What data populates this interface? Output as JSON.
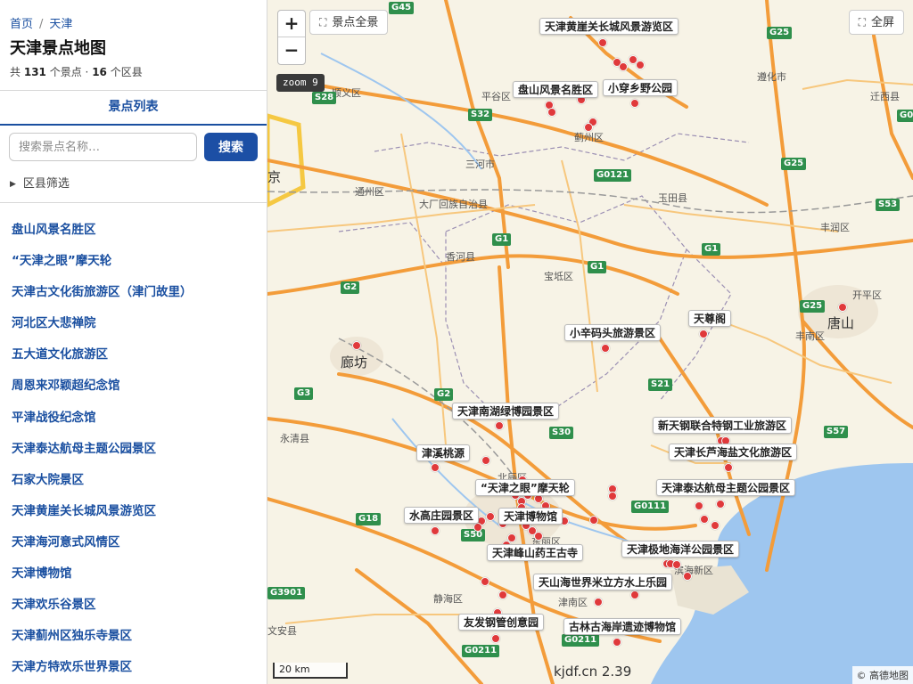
{
  "breadcrumb": {
    "home": "首页",
    "separator": "/",
    "current": "天津"
  },
  "page_title": "天津景点地图",
  "stats": {
    "prefix": "共",
    "poi_count": "131",
    "poi_unit": "个景点 ·",
    "district_count": "16",
    "district_unit": "个区县"
  },
  "tab": {
    "label": "景点列表"
  },
  "search": {
    "placeholder": "搜索景点名称…",
    "button_label": "搜索"
  },
  "filter": {
    "label": "区县筛选",
    "icon": "triangle-right-icon"
  },
  "poi_list": [
    "盘山风景名胜区",
    "“天津之眼”摩天轮",
    "天津古文化街旅游区（津门故里）",
    "河北区大悲禅院",
    "五大道文化旅游区",
    "周恩来邓颖超纪念馆",
    "平津战役纪念馆",
    "天津泰达航母主题公园景区",
    "石家大院景区",
    "天津黄崖关长城风景游览区",
    "天津海河意式风情区",
    "天津博物馆",
    "天津欢乐谷景区",
    "天津蓟州区独乐寺景区",
    "天津方特欢乐世界景区"
  ],
  "map": {
    "zoom_in": "+",
    "zoom_out": "−",
    "overview_label": "景点全景",
    "fullscreen_label": "全屏",
    "zoom_level": "zoom 9",
    "scale": "20 km",
    "watermark": "kjdf.cn 2.39",
    "attribution": "© 高德地图",
    "colors": {
      "marker": "#e0393b",
      "land": "#f7f3e6",
      "sea": "#9ec6ef",
      "road": "#f39c3a",
      "highway_shield": "#2f8f4c",
      "accent": "#1c4fa5"
    },
    "callouts": [
      "天津黄崖关长城风景游览区",
      "盘山风景名胜区",
      "小穿乡野公园",
      "天尊阁",
      "小辛码头旅游景区",
      "天津南湖绿博园景区",
      "新天钢联合特钢工业旅游区",
      "天津长芦海盐文化旅游区",
      "津溪桃源",
      "“天津之眼”摩天轮",
      "天津泰达航母主题公园景区",
      "水高庄园景区",
      "天津博物馆",
      "天津极地海洋公园景区",
      "天津峰山药王古寺",
      "天山海世界米立方水上乐园",
      "友发钢管创意园",
      "古林古海岸遗迹博物馆"
    ],
    "places": [
      "平谷区",
      "顺义区",
      "蓟州区",
      "遵化市",
      "迁西县",
      "三河市",
      "通州区",
      "大厂回族自治县",
      "玉田县",
      "丰润区",
      "香河县",
      "宝坻区",
      "开平区",
      "唐山",
      "丰南区",
      "廊坊",
      "永清县",
      "北辰区",
      "东丽区",
      "静海区",
      "津南区",
      "滨海新区",
      "文安县",
      "京"
    ],
    "shields": [
      "G45",
      "G25",
      "S28",
      "S32",
      "G0121",
      "G25",
      "S53",
      "G1",
      "G1",
      "G1",
      "G2",
      "G25",
      "S21",
      "G2",
      "G3",
      "S30",
      "S57",
      "G0111",
      "S50",
      "G18",
      "G3901",
      "G0211",
      "G0211",
      "G01"
    ]
  }
}
